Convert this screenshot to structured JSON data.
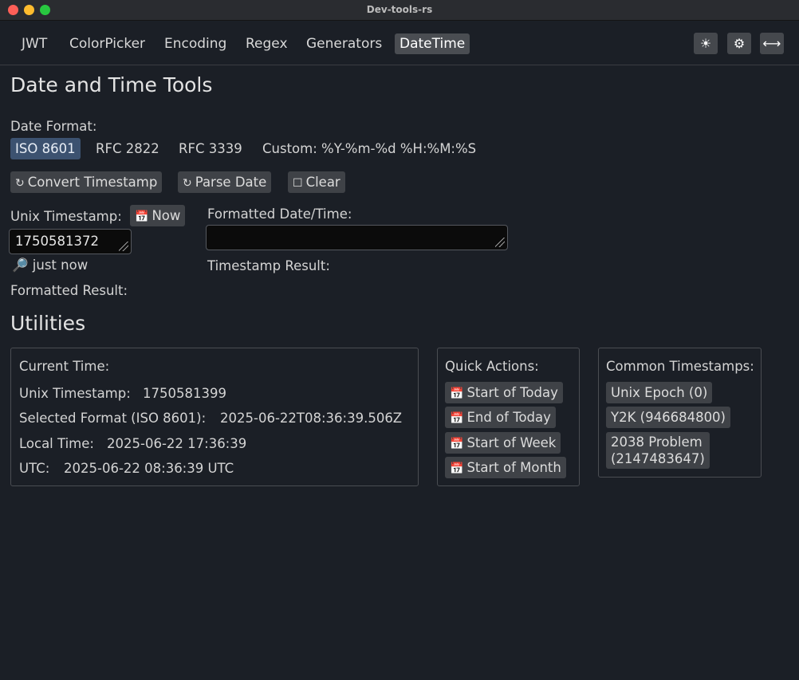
{
  "window": {
    "title": "Dev-tools-rs"
  },
  "nav": {
    "tabs": [
      {
        "label": "JWT"
      },
      {
        "label": "ColorPicker"
      },
      {
        "label": "Encoding"
      },
      {
        "label": "Regex"
      },
      {
        "label": "Generators"
      },
      {
        "label": "DateTime"
      }
    ],
    "active_tab": "DateTime",
    "icons": [
      "sun-icon",
      "gear-icon",
      "expand-horizontal-icon"
    ]
  },
  "page": {
    "title": "Date and Time Tools",
    "date_format_label": "Date Format:",
    "formats": [
      {
        "label": "ISO 8601"
      },
      {
        "label": "RFC 2822"
      },
      {
        "label": "RFC 3339"
      },
      {
        "label": "Custom: %Y-%m-%d %H:%M:%S"
      }
    ],
    "selected_format": "ISO 8601",
    "actions": {
      "convert": "Convert Timestamp",
      "parse": "Parse Date",
      "clear": "Clear"
    },
    "unix_timestamp_label": "Unix Timestamp:",
    "now_button": "Now",
    "unix_timestamp_value": "1750581372",
    "relative_time": "just now",
    "formatted_result_label": "Formatted Result:",
    "formatted_datetime_label": "Formatted Date/Time:",
    "formatted_datetime_value": "",
    "timestamp_result_label": "Timestamp Result:"
  },
  "utilities": {
    "title": "Utilities",
    "current_time": {
      "heading": "Current Time:",
      "unix_label": "Unix Timestamp:",
      "unix_value": "1750581399",
      "selected_label": "Selected Format (ISO 8601):",
      "selected_value": "2025-06-22T08:36:39.506Z",
      "local_label": "Local Time:",
      "local_value": "2025-06-22 17:36:39",
      "utc_label": "UTC:",
      "utc_value": "2025-06-22 08:36:39 UTC"
    },
    "quick_actions": {
      "heading": "Quick Actions:",
      "start_today": "Start of Today",
      "end_today": "End of Today",
      "start_week": "Start of Week",
      "start_month": "Start of Month"
    },
    "common_timestamps": {
      "heading": "Common Timestamps:",
      "epoch": "Unix Epoch (0)",
      "y2k": "Y2K (946684800)",
      "p2038_line1": "2038 Problem",
      "p2038_line2": "(2147483647)"
    }
  },
  "colors": {
    "background": "#1b1f26",
    "selected": "#3c5270",
    "button": "#3f4247"
  }
}
